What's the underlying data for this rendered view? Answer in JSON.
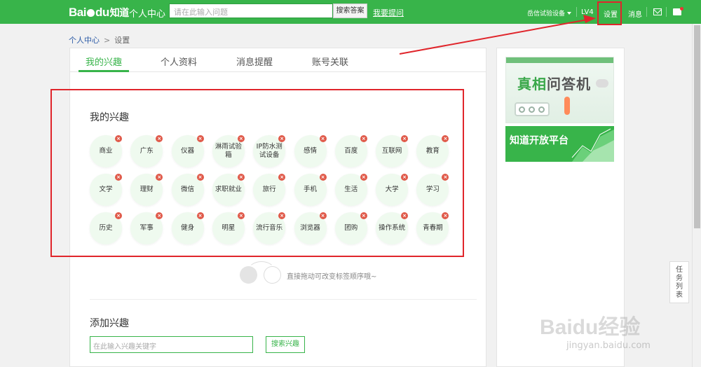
{
  "header": {
    "logo": "Bai",
    "logo_du": "du",
    "logo_zhidao": "知道",
    "section_title": "个人中心",
    "search_placeholder": "请在此输入问题",
    "search_button": "搜索答案",
    "ask_link": "我要提问",
    "username": "岳信试验设备",
    "level": "LV4",
    "settings": "设置",
    "messages": "消息"
  },
  "breadcrumb": {
    "home": "个人中心",
    "separator": ">",
    "current": "设置"
  },
  "tabs": [
    "我的兴趣",
    "个人资料",
    "消息提醒",
    "账号关联"
  ],
  "interests": {
    "title": "我的兴趣",
    "delete_glyph": "×",
    "items": [
      "商业",
      "广东",
      "仪器",
      "淋雨试验箱",
      "IP防水测试设备",
      "感情",
      "百度",
      "互联网",
      "教育",
      "文学",
      "理财",
      "微信",
      "求职就业",
      "旅行",
      "手机",
      "生活",
      "大学",
      "学习",
      "历史",
      "军事",
      "健身",
      "明星",
      "流行音乐",
      "浏览器",
      "团购",
      "操作系统",
      "青春期"
    ],
    "drag_hint": "直接拖动可改变标签顺序哦~"
  },
  "add_interest": {
    "title": "添加兴趣",
    "placeholder": "在此输入兴趣关键字",
    "button": "搜索兴趣"
  },
  "sidebar": {
    "ad1_title_green": "真相",
    "ad1_title_gray": "问答机",
    "ad2_title": "知道开放平台"
  },
  "task_list": [
    "任",
    "务",
    "列",
    "表"
  ],
  "watermark": {
    "brand": "Baidu经验",
    "url": "jingyan.baidu.com"
  },
  "colors": {
    "brand_green": "#38b44a",
    "highlight_red": "#e0252b"
  }
}
